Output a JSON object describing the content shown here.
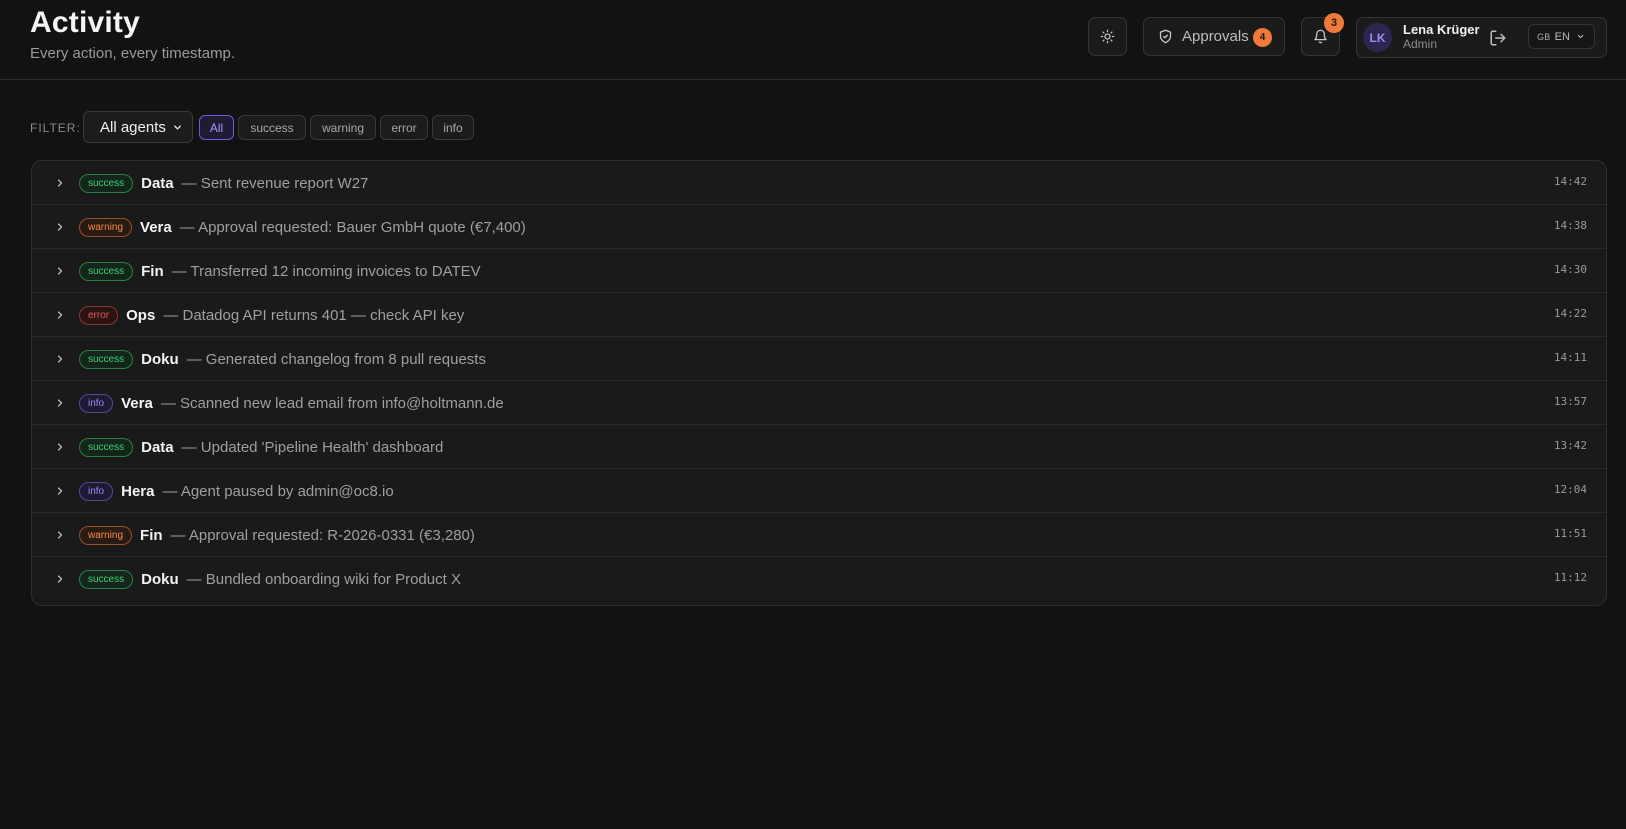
{
  "header": {
    "title": "Activity",
    "subtitle": "Every action, every timestamp.",
    "approvals_label": "Approvals",
    "approvals_count": "4",
    "notifications_count": "3"
  },
  "user": {
    "initials": "LK",
    "name": "Lena Krüger",
    "role": "Admin",
    "lang_flag": "GB",
    "lang_code": "EN"
  },
  "filter": {
    "label": "FILTER:",
    "agent_selected": "All agents",
    "chips": [
      "All",
      "success",
      "warning",
      "error",
      "info"
    ],
    "active_chip": "All"
  },
  "activities": [
    {
      "status": "success",
      "agent": "Data",
      "message": "— Sent revenue report W27",
      "time": "14:42"
    },
    {
      "status": "warning",
      "agent": "Vera",
      "message": "— Approval requested: Bauer GmbH quote (€7,400)",
      "time": "14:38"
    },
    {
      "status": "success",
      "agent": "Fin",
      "message": "— Transferred 12 incoming invoices to DATEV",
      "time": "14:30"
    },
    {
      "status": "error",
      "agent": "Ops",
      "message": "— Datadog API returns 401 — check API key",
      "time": "14:22"
    },
    {
      "status": "success",
      "agent": "Doku",
      "message": "— Generated changelog from 8 pull requests",
      "time": "14:11"
    },
    {
      "status": "info",
      "agent": "Vera",
      "message": "— Scanned new lead email from info@holtmann.de",
      "time": "13:57"
    },
    {
      "status": "success",
      "agent": "Data",
      "message": "— Updated 'Pipeline Health' dashboard",
      "time": "13:42"
    },
    {
      "status": "info",
      "agent": "Hera",
      "message": "— Agent paused by admin@oc8.io",
      "time": "12:04"
    },
    {
      "status": "warning",
      "agent": "Fin",
      "message": "— Approval requested: R-2026-0331 (€3,280)",
      "time": "11:51"
    },
    {
      "status": "success",
      "agent": "Doku",
      "message": "— Bundled onboarding wiki for Product X",
      "time": "11:12"
    }
  ],
  "colors": {
    "background": "#121212",
    "accent": "#6a5ae0",
    "badge": "#f07a3a",
    "success": "#3ecf74",
    "warning": "#f58a4b",
    "error": "#ef5757",
    "info": "#9d8ef3"
  },
  "icons": {
    "theme": "sun-icon",
    "approvals": "shield-check-icon",
    "notifications": "bell-icon",
    "logout": "logout-icon",
    "row_expand": "chevron-right-icon",
    "dropdown": "chevron-down-icon"
  }
}
